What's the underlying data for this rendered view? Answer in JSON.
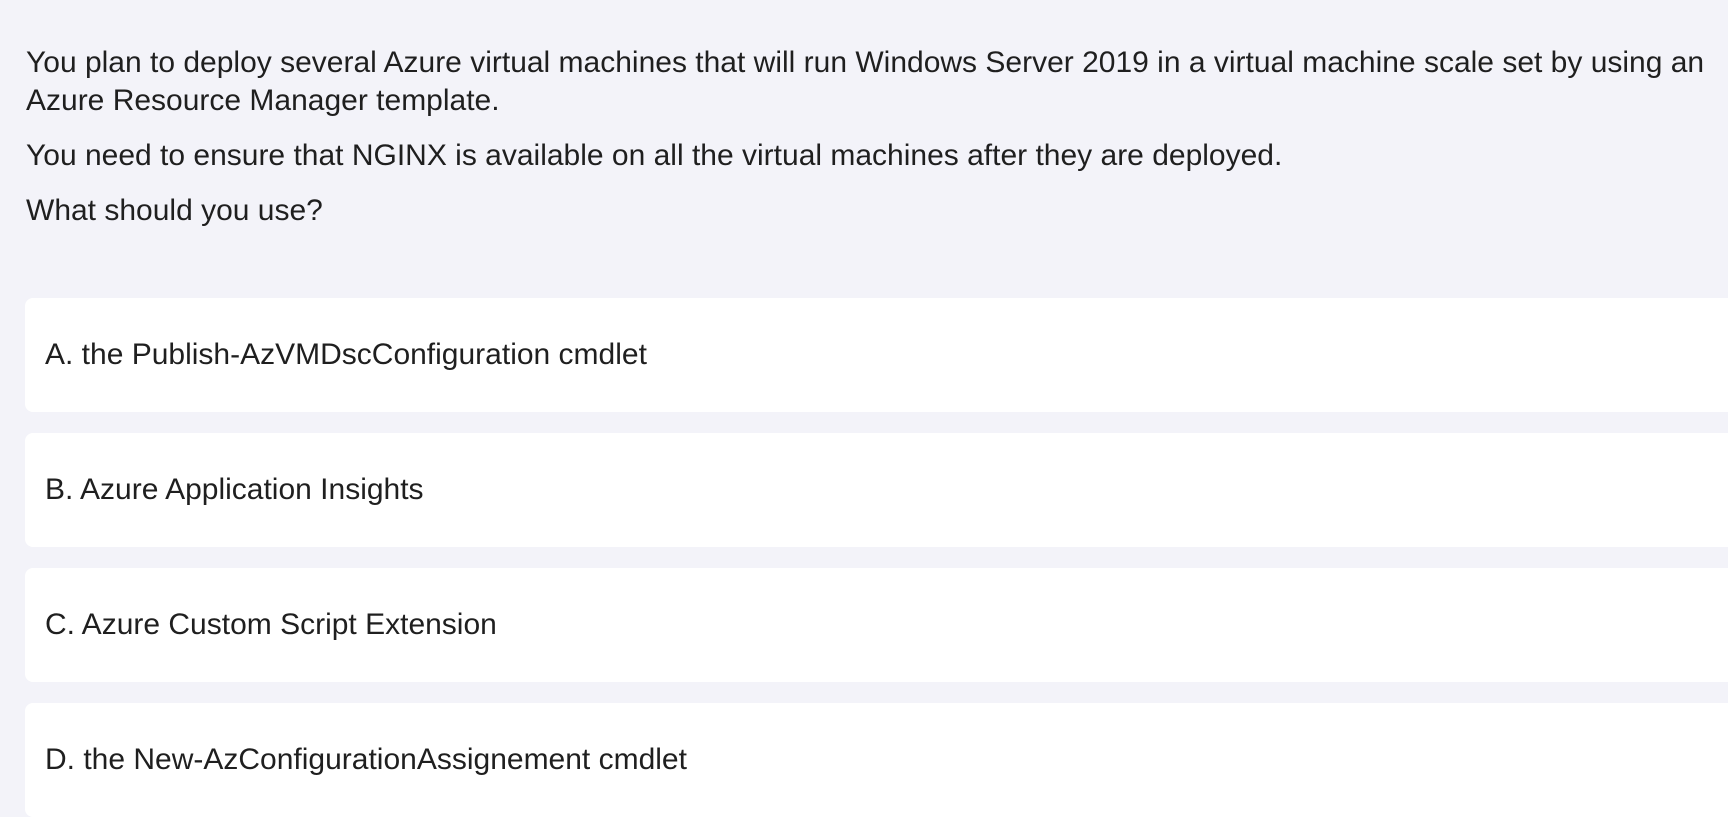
{
  "question": {
    "paragraphs": [
      "You plan to deploy several Azure virtual machines that will run Windows Server 2019 in a virtual machine scale set by using an Azure Resource Manager template.",
      "You need to ensure that NGINX is available on all the virtual machines after they are deployed.",
      "What should you use?"
    ]
  },
  "options": [
    {
      "label": "A. the Publish-AzVMDscConfiguration cmdlet"
    },
    {
      "label": "B. Azure Application Insights"
    },
    {
      "label": "C. Azure Custom Script Extension"
    },
    {
      "label": "D. the New-AzConfigurationAssignement cmdlet"
    }
  ],
  "colors": {
    "background": "#f3f3f9",
    "card": "#ffffff",
    "text": "#1f1f1f"
  }
}
